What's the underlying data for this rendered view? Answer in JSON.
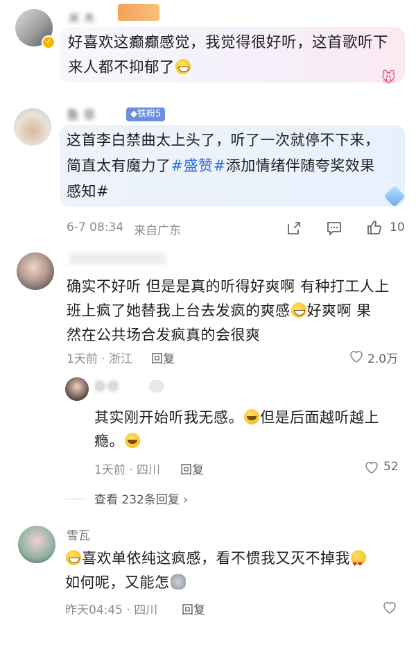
{
  "comments": [
    {
      "user": "米 木",
      "text_line1": "好喜欢这癫癫感觉，我觉得很好听，这首歌听下",
      "text_line2": "来人都不抑郁了"
    },
    {
      "user": "鱼 非",
      "badge": "铁粉5",
      "text_line1": "这首李白禁曲太上头了，听了一次就停不下来，",
      "text_line2_a": "简直太有魔力了",
      "hashtag": "#盛赞#",
      "text_line2_b": "添加情绪伴随夸奖效果",
      "text_line3": "感知#",
      "time": "6-7 08:34",
      "location": "来自广东",
      "likes": "10"
    },
    {
      "text_line1": "确实不好听 但是是真的听得好爽啊 有种打工人上",
      "text_line2_a": "班上疯了她替我上台去发疯的爽感",
      "text_line2_b": "好爽啊 果",
      "text_line3": "然在公共场合发疯真的会很爽",
      "time": "1天前 · 浙江",
      "reply_label": "回复",
      "likes": "2.0万"
    },
    {
      "user": "D O",
      "text_line1_a": "其实刚开始听我无感。",
      "text_line1_b": "但是后面越听越上",
      "text_line2": "瘾。",
      "time": "1天前 · 四川",
      "reply_label": "回复",
      "likes": "52"
    },
    {
      "view_replies": "查看 232条回复"
    },
    {
      "user": "雪瓦",
      "text_line1_a": "喜欢单依纯这疯感，看不惯我又灭不掉我",
      "text_line2": "如何呢，又能怎",
      "time": "昨天04:45 · 四川",
      "reply_label": "回复"
    }
  ],
  "colors": {
    "hashtag": "#2f6fd6",
    "badge": "#6a8fe0"
  }
}
